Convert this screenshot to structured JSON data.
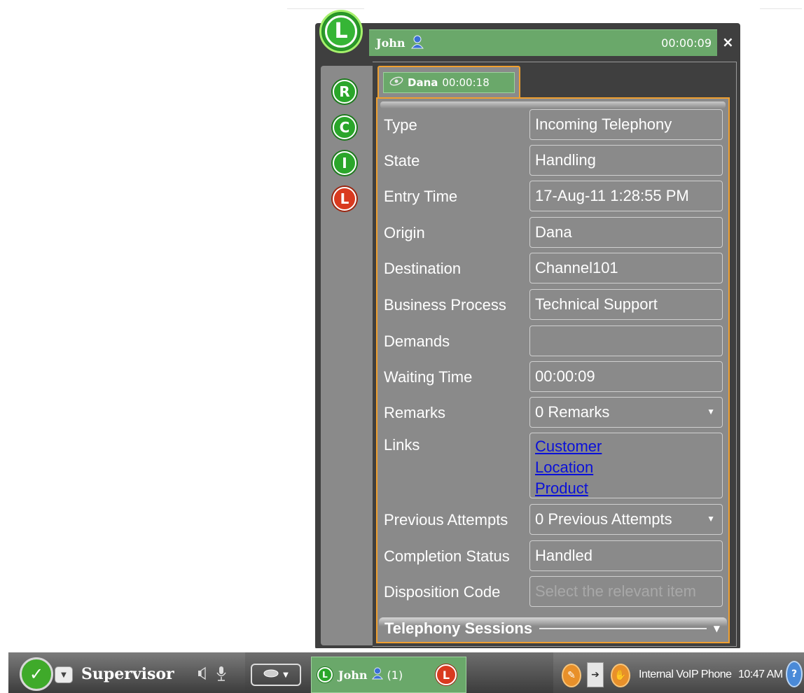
{
  "call_window": {
    "contact_name": "John",
    "call_timer": "00:00:09",
    "avatar_letter": "L",
    "close_symbol": "×"
  },
  "status_badges": [
    {
      "letter": "R",
      "color": "green"
    },
    {
      "letter": "C",
      "color": "green"
    },
    {
      "letter": "I",
      "color": "green"
    },
    {
      "letter": "L",
      "color": "red"
    }
  ],
  "interaction_tab": {
    "name": "Dana",
    "timer": "00:00:18",
    "icon": "eye-icon"
  },
  "details": {
    "type_label": "Type",
    "type_value": "Incoming Telephony",
    "state_label": "State",
    "state_value": "Handling",
    "entry_time_label": "Entry Time",
    "entry_time_value": "17-Aug-11 1:28:55 PM",
    "origin_label": "Origin",
    "origin_value": "Dana",
    "destination_label": "Destination",
    "destination_value": "Channel101",
    "business_process_label": "Business Process",
    "business_process_value": "Technical Support",
    "demands_label": "Demands",
    "demands_value": "",
    "waiting_time_label": "Waiting Time",
    "waiting_time_value": "00:00:09",
    "remarks_label": "Remarks",
    "remarks_value": "0 Remarks",
    "links_label": "Links",
    "links": [
      "Customer",
      "Location",
      "Product"
    ],
    "previous_attempts_label": "Previous Attempts",
    "previous_attempts_value": "0 Previous Attempts",
    "completion_status_label": "Completion Status",
    "completion_status_value": "Handled",
    "disposition_code_label": "Disposition Code",
    "disposition_code_placeholder": "Select the relevant item"
  },
  "sessions_section": {
    "label": "Telephony Sessions"
  },
  "taskbar": {
    "status_label": "Supervisor",
    "active_call_name": "John",
    "active_call_count": "(1)",
    "green_badge_letter": "L",
    "red_badge_letter": "L",
    "phone_type": "Internal VoIP Phone",
    "clock": "10:47 AM",
    "help_symbol": "?"
  },
  "colors": {
    "accent_green": "#6aa86a",
    "tab_border_orange": "#f0a030",
    "link_blue": "#0a10d9",
    "panel_gray": "#8a8a8a"
  }
}
